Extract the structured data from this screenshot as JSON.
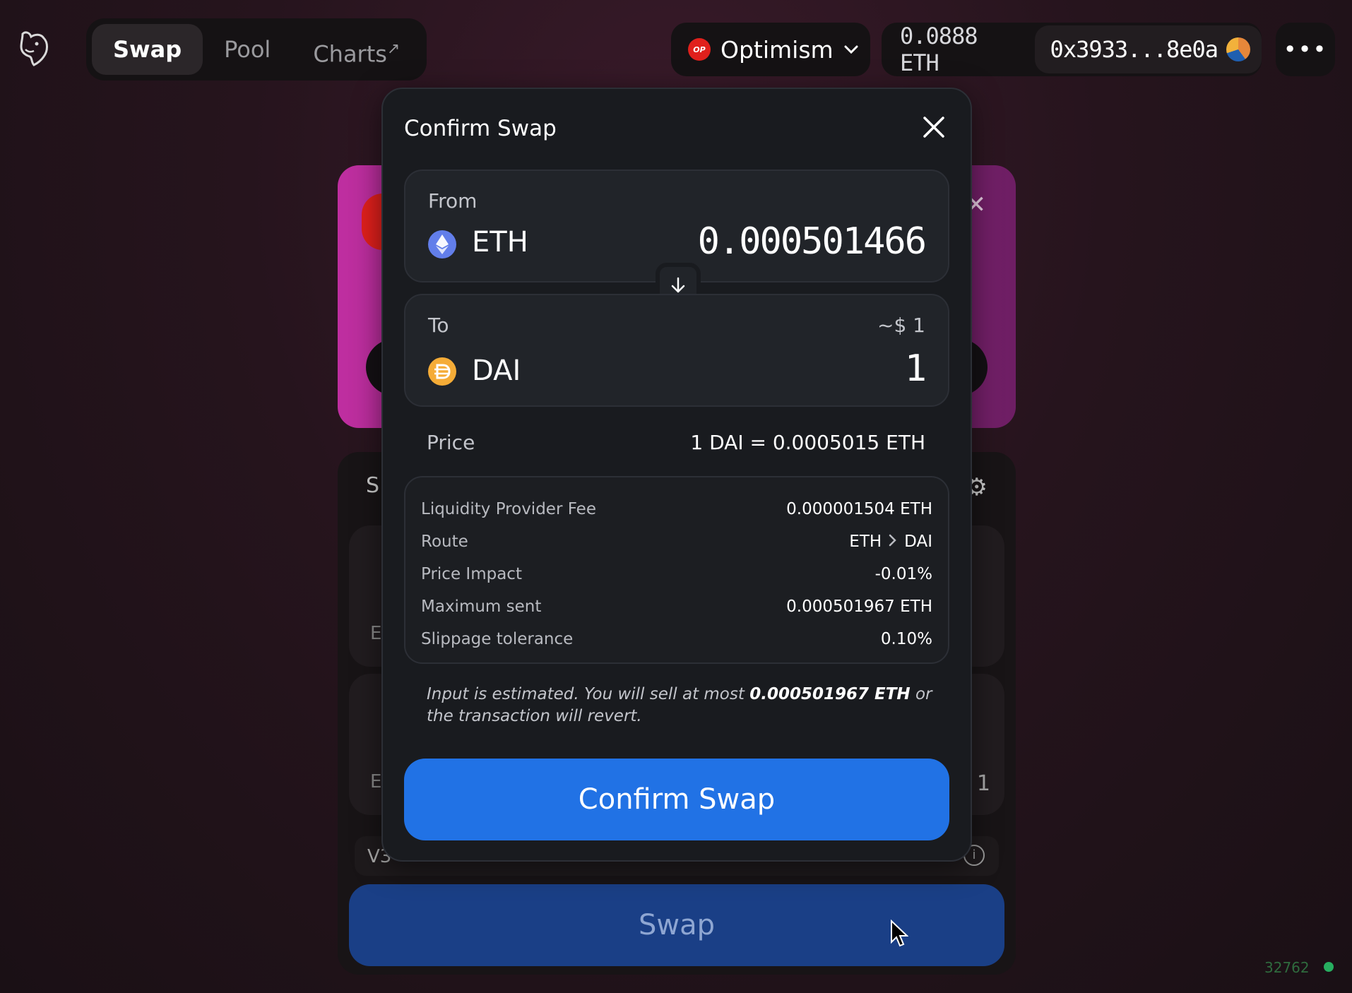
{
  "nav": {
    "tabs": [
      {
        "label": "Swap",
        "active": true
      },
      {
        "label": "Pool",
        "active": false
      },
      {
        "label": "Charts",
        "active": false
      }
    ],
    "charts_ext": "↗",
    "network": "Optimism",
    "network_badge": "OP",
    "balance": "0.0888 ETH",
    "address": "0x3933...8e0a",
    "more": "•••"
  },
  "background": {
    "widget_title_initial": "S",
    "panel_a_letter": "E",
    "panel_b_letter": "E",
    "panel_b_right": "1",
    "version_label": "V3",
    "swap_button": "Swap",
    "block_number": "32762"
  },
  "modal": {
    "title": "Confirm Swap",
    "from": {
      "label": "From",
      "symbol": "ETH",
      "amount": "0.000501466"
    },
    "to": {
      "label": "To",
      "symbol": "DAI",
      "amount": "1",
      "usd": "~$ 1"
    },
    "price": {
      "label": "Price",
      "value": "1 DAI = 0.0005015 ETH"
    },
    "details": [
      {
        "label": "Liquidity Provider Fee",
        "value": "0.000001504 ETH"
      },
      {
        "label": "Route",
        "from": "ETH",
        "to": "DAI"
      },
      {
        "label": "Price Impact",
        "value": "-0.01%"
      },
      {
        "label": "Maximum sent",
        "value": "0.000501967 ETH"
      },
      {
        "label": "Slippage tolerance",
        "value": "0.10%"
      }
    ],
    "note": {
      "prefix": "Input is estimated. You will sell at most ",
      "amount": "0.000501967 ETH",
      "suffix": " or the transaction will revert."
    },
    "confirm_button": "Confirm Swap"
  },
  "colors": {
    "confirm_blue": "#2172e5",
    "modal_bg": "#191b1f",
    "eth_icon": "#627eea",
    "dai_icon": "#f5ac37",
    "optimism_red": "#e0201c"
  }
}
